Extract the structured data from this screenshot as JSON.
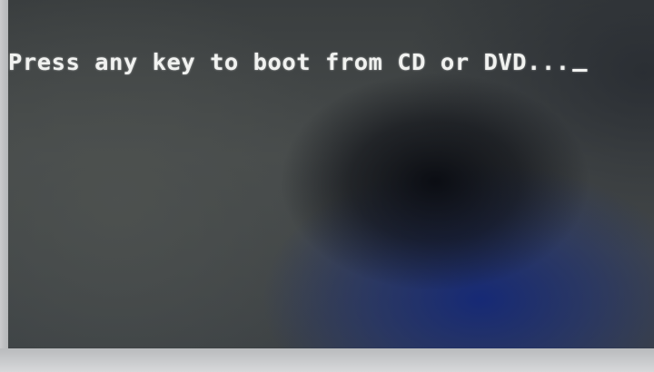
{
  "screen": {
    "message": "Press any key to boot from CD or DVD..."
  },
  "colors": {
    "text": "#f1f2f0",
    "background": "#3d4142",
    "shadow_blue": "#1e2e78"
  }
}
